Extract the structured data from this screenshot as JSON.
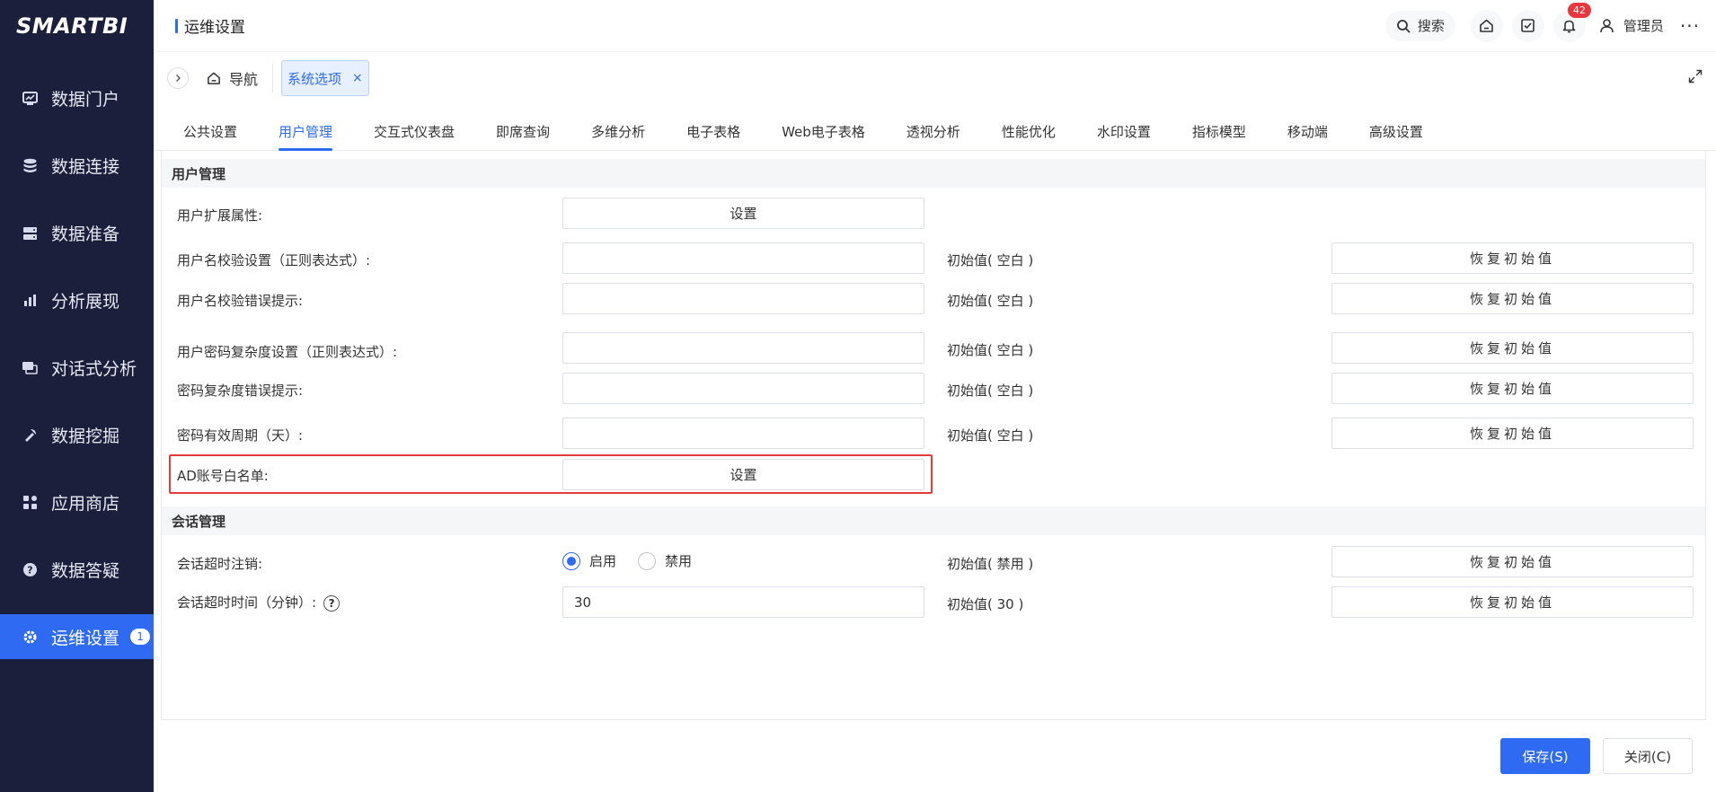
{
  "app": {
    "logo": "SMARTBI"
  },
  "colors": {
    "accent": "#2f6bf2",
    "sidebar_bg": "#1c1f3b",
    "highlight": "#e23b3b",
    "badge": "#e8373d"
  },
  "sidebar": {
    "items": [
      {
        "label": "数据门户",
        "icon": "portal-icon"
      },
      {
        "label": "数据连接",
        "icon": "database-icon"
      },
      {
        "label": "数据准备",
        "icon": "server-icon"
      },
      {
        "label": "分析展现",
        "icon": "bar-chart-icon"
      },
      {
        "label": "对话式分析",
        "icon": "chat-icon"
      },
      {
        "label": "数据挖掘",
        "icon": "pickaxe-icon"
      },
      {
        "label": "应用商店",
        "icon": "grid-icon"
      },
      {
        "label": "数据答疑",
        "icon": "question-icon"
      },
      {
        "label": "运维设置",
        "icon": "gear-icon",
        "active": true,
        "badge": "1"
      }
    ]
  },
  "header": {
    "title": "运维设置",
    "search_label": "搜索",
    "notification_count": "42",
    "user_name": "管理员",
    "more": "···"
  },
  "crumbs": {
    "nav_label": "导航",
    "open_tab": "系统选项",
    "close_symbol": "×"
  },
  "tabs": [
    {
      "label": "公共设置"
    },
    {
      "label": "用户管理",
      "active": true
    },
    {
      "label": "交互式仪表盘"
    },
    {
      "label": "即席查询"
    },
    {
      "label": "多维分析"
    },
    {
      "label": "电子表格"
    },
    {
      "label": "Web电子表格"
    },
    {
      "label": "透视分析"
    },
    {
      "label": "性能优化"
    },
    {
      "label": "水印设置"
    },
    {
      "label": "指标模型"
    },
    {
      "label": "移动端"
    },
    {
      "label": "高级设置"
    }
  ],
  "user_mgmt": {
    "section_title": "用户管理",
    "ext_attr_label": "用户扩展属性:",
    "ext_attr_button": "设置",
    "rows": [
      {
        "label": "用户名校验设置（正则表达式）:",
        "value": "",
        "init": "初始值( 空白 )",
        "reset": "恢复初始值"
      },
      {
        "label": "用户名校验错误提示:",
        "value": "",
        "init": "初始值( 空白 )",
        "reset": "恢复初始值"
      },
      {
        "label": "用户密码复杂度设置（正则表达式）:",
        "value": "",
        "init": "初始值( 空白 )",
        "reset": "恢复初始值"
      },
      {
        "label": "密码复杂度错误提示:",
        "value": "",
        "init": "初始值( 空白 )",
        "reset": "恢复初始值"
      },
      {
        "label": "密码有效周期（天）:",
        "value": "",
        "init": "初始值( 空白 )",
        "reset": "恢复初始值"
      }
    ],
    "ad_whitelist_label": "AD账号白名单:",
    "ad_whitelist_button": "设置"
  },
  "session_mgmt": {
    "section_title": "会话管理",
    "timeout_logout_label": "会话超时注销:",
    "radio_enable": "启用",
    "radio_disable": "禁用",
    "selected": "启用",
    "timeout_logout_init": "初始值( 禁用 )",
    "timeout_logout_reset": "恢复初始值",
    "timeout_minutes_label": "会话超时时间（分钟）:",
    "help_symbol": "?",
    "timeout_minutes_value": "30",
    "timeout_minutes_init": "初始值( 30 )",
    "timeout_minutes_reset": "恢复初始值"
  },
  "footer": {
    "save_label": "保存(S)",
    "close_label": "关闭(C)"
  }
}
